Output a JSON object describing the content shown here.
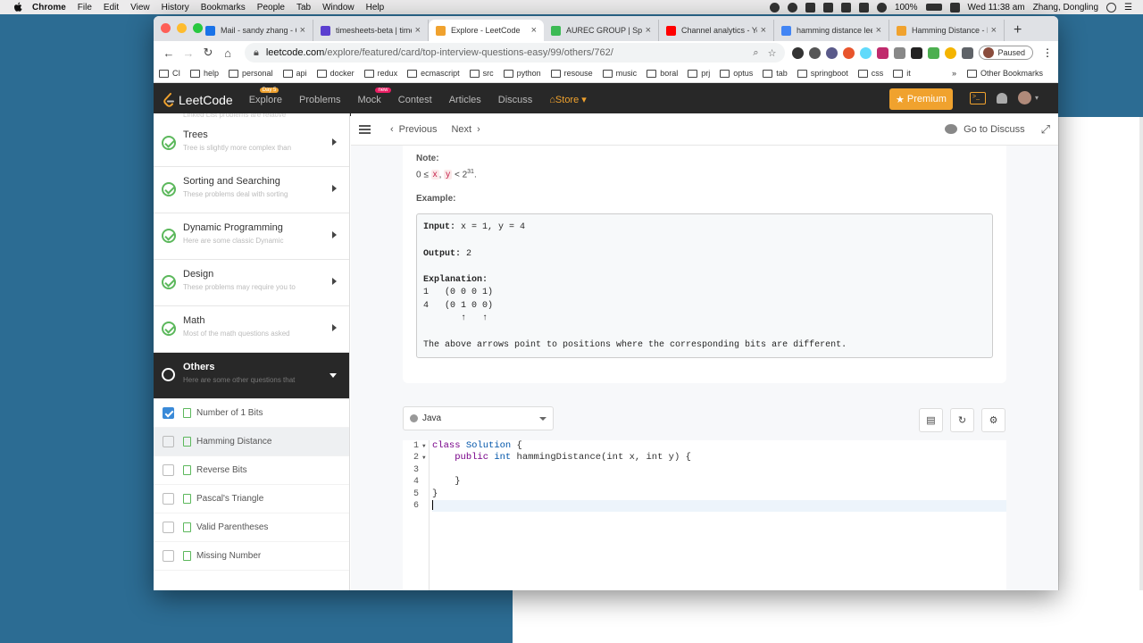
{
  "mac_menu": {
    "items": [
      "Chrome",
      "File",
      "Edit",
      "View",
      "History",
      "Bookmarks",
      "People",
      "Tab",
      "Window",
      "Help"
    ],
    "battery": "100%",
    "clock": "Wed 11:38 am",
    "user": "Zhang, Dongling"
  },
  "browser": {
    "tabs": [
      {
        "title": "Mail - sandy zhang - O",
        "color": "#1a73e8"
      },
      {
        "title": "timesheets-beta | time",
        "color": "#5b3fd0"
      },
      {
        "title": "Explore - LeetCode",
        "color": "#f0a22e"
      },
      {
        "title": "AUREC GROUP | Spec",
        "color": "#3cba54"
      },
      {
        "title": "Channel analytics - Yo",
        "color": "#ff0000"
      },
      {
        "title": "hamming distance leet",
        "color": "#4285f4"
      },
      {
        "title": "Hamming Distance - L",
        "color": "#f0a22e"
      }
    ],
    "active_tab": 2,
    "url_host": "leetcode.com",
    "url_path": "/explore/featured/card/top-interview-questions-easy/99/others/762/",
    "profile_label": "Paused",
    "bookmarks": [
      "CI",
      "help",
      "personal",
      "api",
      "docker",
      "redux",
      "ecmascript",
      "src",
      "python",
      "resouse",
      "music",
      "boral",
      "prj",
      "optus",
      "tab",
      "springboot",
      "css",
      "it"
    ],
    "bookmarks_more": "»",
    "other_bookmarks": "Other Bookmarks"
  },
  "leetcode_nav": {
    "logo": "LeetCode",
    "items": [
      "Explore",
      "Problems",
      "Mock",
      "Contest",
      "Articles",
      "Discuss"
    ],
    "explore_badge": "Day 5",
    "mock_badge": "new",
    "store": "Store",
    "premium": "Premium"
  },
  "sidebar": {
    "cutoff_text": "Linked List problems are relative",
    "cards": [
      {
        "title": "Trees",
        "desc": "Tree is slightly more complex than"
      },
      {
        "title": "Sorting and Searching",
        "desc": "These problems deal with sorting"
      },
      {
        "title": "Dynamic Programming",
        "desc": "Here are some classic Dynamic"
      },
      {
        "title": "Design",
        "desc": "These problems may require you to"
      },
      {
        "title": "Math",
        "desc": "Most of the math questions asked"
      }
    ],
    "active_card": {
      "title": "Others",
      "desc": "Here are some other questions that"
    },
    "questions": [
      {
        "label": "Number of 1 Bits",
        "checked": true
      },
      {
        "label": "Hamming Distance",
        "checked": false
      },
      {
        "label": "Reverse Bits",
        "checked": false
      },
      {
        "label": "Pascal's Triangle",
        "checked": false
      },
      {
        "label": "Valid Parentheses",
        "checked": false
      },
      {
        "label": "Missing Number",
        "checked": false
      }
    ]
  },
  "toolbar": {
    "previous": "Previous",
    "next": "Next",
    "discuss": "Go to Discuss"
  },
  "description": {
    "note_label": "Note:",
    "note_prefix": "0 ≤",
    "var_x": "x",
    "comma": ",",
    "var_y": "y",
    "lt": "< 2",
    "exp": "31",
    "period": ".",
    "example_label": "Example:",
    "input_label": "Input:",
    "input_value": " x = 1, y = 4",
    "output_label": "Output:",
    "output_value": " 2",
    "explanation_label": "Explanation:",
    "exp_line1": "1   (0 0 0 1)",
    "exp_line2": "4   (0 1 0 0)",
    "exp_line3": "       ↑   ↑",
    "exp_line4": "The above arrows point to positions where the corresponding bits are different."
  },
  "editor": {
    "language": "Java",
    "line_numbers": [
      "1",
      "2",
      "3",
      "4",
      "5",
      "6"
    ],
    "code": {
      "l1_kw": "class",
      "l1_name": " Solution",
      "l1_rest": " {",
      "l2_indent": "    ",
      "l2_kw": "public",
      "l2_type": " int",
      "l2_rest": " hammingDistance(int x, int y) {",
      "l3": "",
      "l4": "    }",
      "l5": "}"
    }
  }
}
